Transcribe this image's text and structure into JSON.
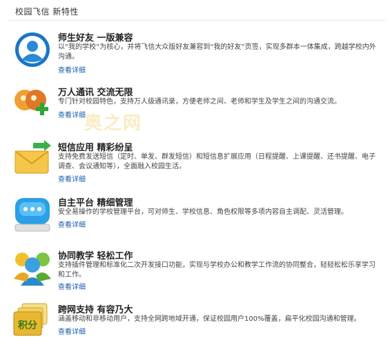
{
  "header": {
    "title": "校园飞信 新特性"
  },
  "features": [
    {
      "title": "师生好友 一版兼容",
      "desc": "以“我的学校”为核心，并将飞信大众版好友兼容到“我的好友”页签，实现多群本一体集成，跨越学校内外沟通。",
      "more": "查看详细",
      "icon": "contact-person-icon"
    },
    {
      "title": "万人通讯 交流无限",
      "desc": "专门针对校园特色，支持万人级通讯录，方便老师之间、老师和学生及学生之间的沟通交流。",
      "more": "查看详细",
      "icon": "group-add-icon"
    },
    {
      "title": "短信应用 精彩纷呈",
      "desc": "支持免费发送短信（定时、单发、群发短信）和短信息扩展应用（日程提醒、上课提醒、还书提醒、电子调查、会议通知等），全面融入校园生活。",
      "more": "查看详细",
      "icon": "envelope-icon"
    },
    {
      "title": "自主平台 精细管理",
      "desc": "安全易操作的学校管理平台，可对师生、学校信息、角色权限等多项内容自主调配、灵活管理。",
      "more": "查看详细",
      "icon": "chat-bubble-icon"
    },
    {
      "title": "协同教学 轻松工作",
      "desc": "支持插件管理和标准化二次开发接口功能，实现与学校办公和教学工作流的协同整合，轻轻松松乐享学习和工作。",
      "more": "查看详细",
      "icon": "users-icon"
    },
    {
      "title": "跨网支持 有容乃大",
      "desc": "涵盖移动和非移动用户，支持全网跨地域开通，保证校园用户100%覆盖，扁平化校园沟通和管理。",
      "more": "查看详细",
      "icon": "points-card-icon"
    }
  ],
  "watermark": "奥之网",
  "colors": {
    "link": "#1d5cab",
    "divider": "#e6e6e6",
    "title": "#222222"
  }
}
